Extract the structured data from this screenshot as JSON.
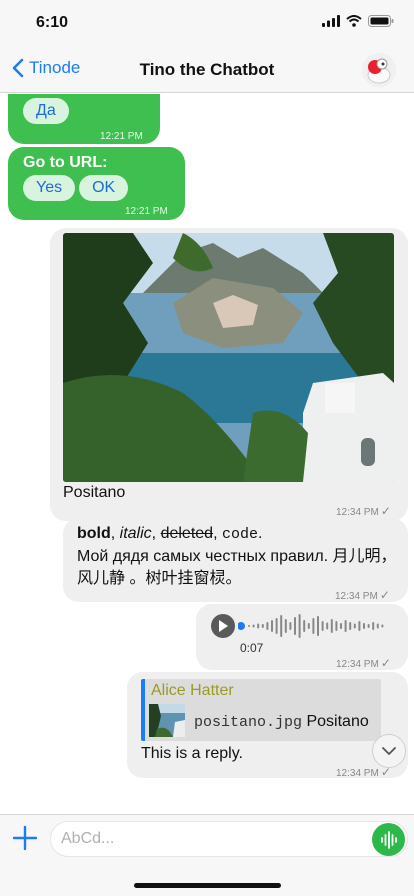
{
  "status": {
    "time": "6:10"
  },
  "nav": {
    "back_label": "Tinode",
    "title": "Tino the Chatbot"
  },
  "messages": {
    "m1": {
      "chip": "Да",
      "time": "12:21 PM"
    },
    "m2": {
      "title": "Go to URL:",
      "chips": [
        "Yes",
        "OK"
      ],
      "time": "12:21 PM"
    },
    "m3": {
      "caption": "Positano",
      "time": "12:34 PM"
    },
    "m4": {
      "bold": "bold",
      "italic": "italic",
      "deleted": "deleted",
      "code": "code",
      "sep1": ", ",
      "sep2": ", ",
      "sep3": ", ",
      "end": ".",
      "line2": "Мой дядя самых честных правил. 月儿明，风儿静 。树叶挂窗棂。",
      "time": "12:34 PM"
    },
    "m5": {
      "duration": "0:07",
      "time": "12:34 PM"
    },
    "m6": {
      "quote_author": "Alice Hatter",
      "quote_file": "positano.jpg",
      "quote_caption": "Positano",
      "text": "This is a reply.",
      "time": "12:34 PM"
    }
  },
  "composer": {
    "placeholder": "AbCd..."
  },
  "colors": {
    "accent": "#1d7cf2",
    "incoming": "#3fbf4f",
    "outgoing": "#efefef",
    "quote_author": "#9a9a26"
  },
  "icons": [
    "chevron-left-icon",
    "signal-icon",
    "wifi-icon",
    "battery-icon",
    "play-icon",
    "checkmark-icon",
    "chevron-down-icon",
    "plus-icon",
    "waveform-icon"
  ]
}
